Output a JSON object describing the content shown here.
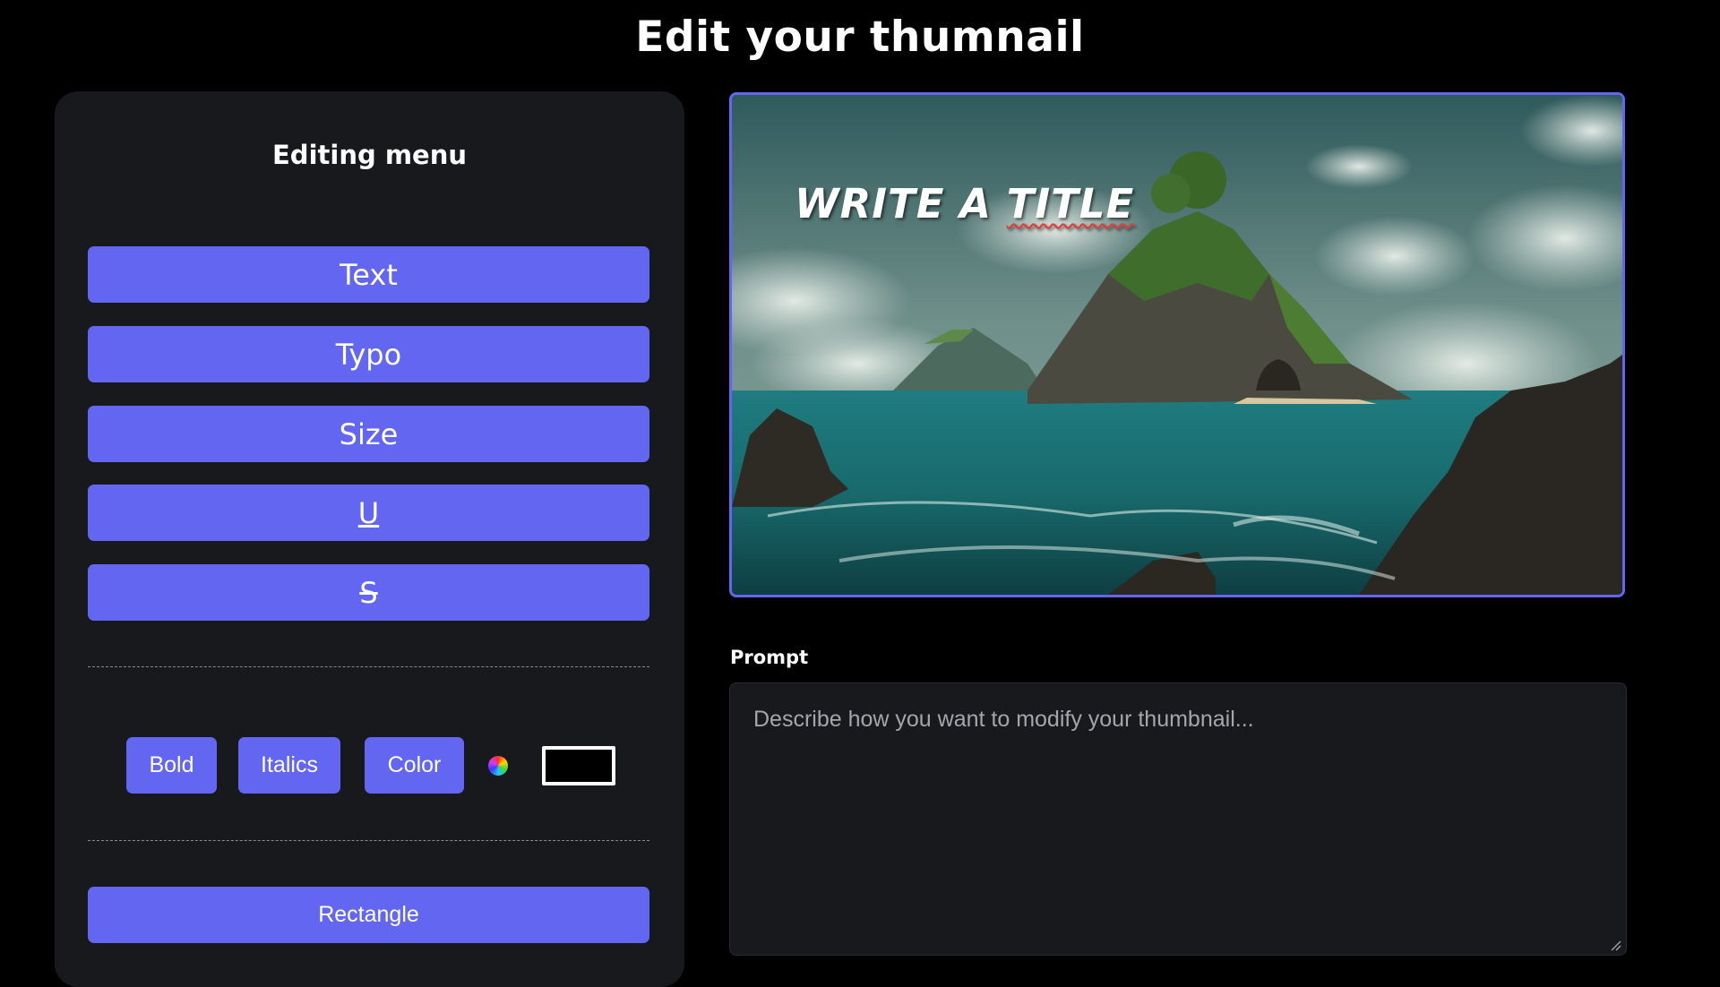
{
  "header": {
    "title": "Edit your thumnail"
  },
  "editing_menu": {
    "title": "Editing menu",
    "buttons": {
      "text": "Text",
      "typo": "Typo",
      "size": "Size",
      "underline": "U",
      "strikethrough": "S"
    },
    "style_buttons": {
      "bold": "Bold",
      "italics": "Italics",
      "color": "Color"
    },
    "selected_color": "#000000",
    "rectangle": "Rectangle"
  },
  "thumbnail": {
    "title_text_1": "WRITE A ",
    "title_text_2": "TITLE"
  },
  "prompt": {
    "label": "Prompt",
    "placeholder": "Describe how you want to modify your thumbnail...",
    "value": ""
  },
  "colors": {
    "accent": "#6366f1",
    "panel_bg": "#18191d",
    "page_bg": "#000000"
  }
}
